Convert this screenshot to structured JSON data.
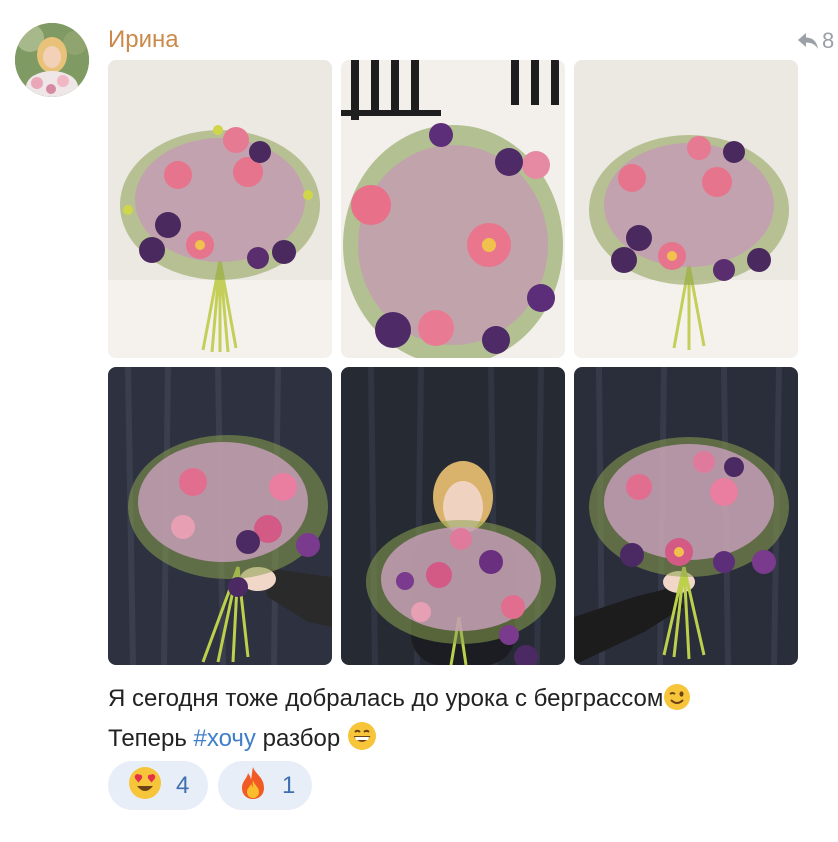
{
  "post": {
    "author": "Ирина",
    "reply_count": "8",
    "text_line1": "Я сегодня тоже добралась до урока с берграссом",
    "text_line2_pre": "Теперь ",
    "hashtag": "#хочу",
    "text_line2_post": " разбор"
  },
  "photos": [
    {
      "label": "bouquet-on-table"
    },
    {
      "label": "bouquet-top-view"
    },
    {
      "label": "bouquet-on-table-2"
    },
    {
      "label": "bouquet-in-hand"
    },
    {
      "label": "woman-with-bouquet"
    },
    {
      "label": "bouquet-in-hand-2"
    }
  ],
  "reactions": [
    {
      "emoji": "heart-eyes-icon",
      "count": "4"
    },
    {
      "emoji": "fire-icon",
      "count": "1"
    }
  ],
  "colors": {
    "author": "#cb8a4a",
    "hashtag": "#3f7fc9",
    "reaction_bg": "#e8eef7",
    "reaction_count": "#3f6fb0"
  }
}
